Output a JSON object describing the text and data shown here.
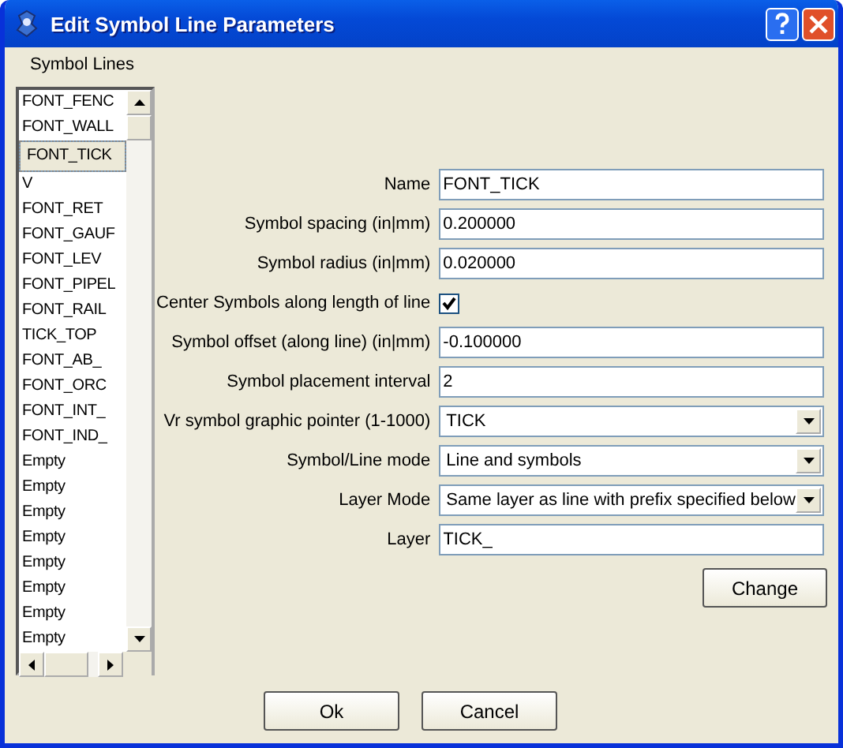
{
  "window": {
    "title": "Edit Symbol Line Parameters"
  },
  "symbol_lines": {
    "label": "Symbol Lines",
    "items": [
      {
        "label": "FONT_FENC",
        "selected": false
      },
      {
        "label": "FONT_WALL",
        "selected": false
      },
      {
        "label": "FONT_TICK",
        "selected": true
      },
      {
        "label": "V",
        "selected": false
      },
      {
        "label": "FONT_RET",
        "selected": false
      },
      {
        "label": "FONT_GAUF",
        "selected": false
      },
      {
        "label": "FONT_LEV",
        "selected": false
      },
      {
        "label": "FONT_PIPEL",
        "selected": false
      },
      {
        "label": "FONT_RAIL",
        "selected": false
      },
      {
        "label": "TICK_TOP",
        "selected": false
      },
      {
        "label": "FONT_AB_",
        "selected": false
      },
      {
        "label": "FONT_ORC",
        "selected": false
      },
      {
        "label": "FONT_INT_",
        "selected": false
      },
      {
        "label": "FONT_IND_",
        "selected": false
      },
      {
        "label": "Empty",
        "selected": false
      },
      {
        "label": "Empty",
        "selected": false
      },
      {
        "label": "Empty",
        "selected": false
      },
      {
        "label": "Empty",
        "selected": false
      },
      {
        "label": "Empty",
        "selected": false
      },
      {
        "label": "Empty",
        "selected": false
      },
      {
        "label": "Empty",
        "selected": false
      },
      {
        "label": "Empty",
        "selected": false
      }
    ]
  },
  "fields": [
    {
      "kind": "text",
      "label": "Name",
      "value": "FONT_TICK"
    },
    {
      "kind": "text",
      "label": "Symbol spacing (in|mm)",
      "value": "0.200000"
    },
    {
      "kind": "text",
      "label": "Symbol radius (in|mm)",
      "value": "0.020000"
    },
    {
      "kind": "checkbox",
      "label": "Center Symbols along length of line",
      "checked": true
    },
    {
      "kind": "text",
      "label": "Symbol offset (along line) (in|mm)",
      "value": "-0.100000"
    },
    {
      "kind": "text",
      "label": "Symbol placement interval",
      "value": "2"
    },
    {
      "kind": "select",
      "label": "Vr symbol graphic pointer (1-1000)",
      "value": "TICK"
    },
    {
      "kind": "select",
      "label": "Symbol/Line mode",
      "value": "Line and symbols"
    },
    {
      "kind": "select",
      "label": "Layer Mode",
      "value": "Same layer as line with prefix specified below"
    },
    {
      "kind": "text",
      "label": "Layer",
      "value": "TICK_"
    }
  ],
  "change_button": "Change",
  "buttons": [
    "Ok",
    "Cancel"
  ]
}
